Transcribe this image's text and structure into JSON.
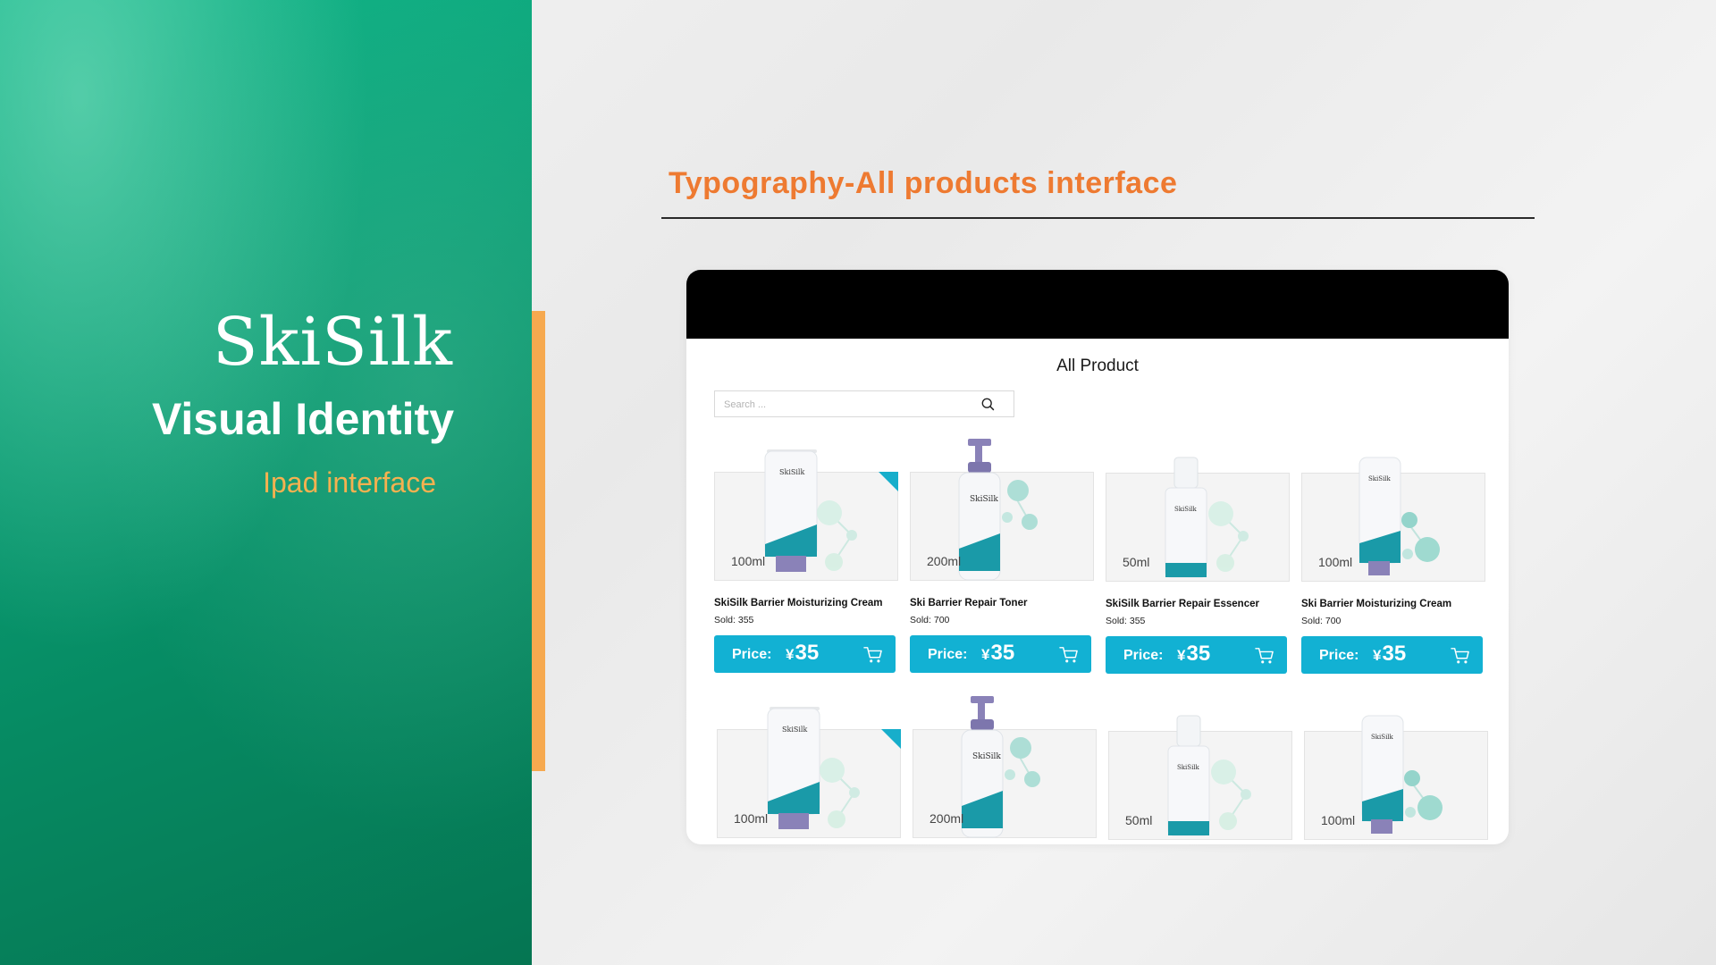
{
  "brand": {
    "logo": "SkiSilk",
    "title": "Visual Identity",
    "subtitle": "Ipad interface"
  },
  "section": {
    "heading": "Typography-All products interface"
  },
  "app": {
    "title": "All Product",
    "search": {
      "placeholder": "Search ...",
      "value": ""
    },
    "products": [
      {
        "name": "SkiSilk Barrier Moisturizing Cream",
        "sold": "Sold: 355",
        "volume": "100ml",
        "price_label": "Price:",
        "currency": "¥",
        "price": "35",
        "kind": "tube",
        "tagged": true
      },
      {
        "name": "Ski Barrier Repair Toner",
        "sold": "Sold: 700",
        "volume": "200ml",
        "price_label": "Price:",
        "currency": "¥",
        "price": "35",
        "kind": "pump",
        "tagged": false
      },
      {
        "name": "SkiSilk Barrier Repair Essencer",
        "sold": "Sold: 355",
        "volume": "50ml",
        "price_label": "Price:",
        "currency": "¥",
        "price": "35",
        "kind": "foam",
        "tagged": false
      },
      {
        "name": "Ski Barrier Moisturizing Cream",
        "sold": "Sold: 700",
        "volume": "100ml",
        "price_label": "Price:",
        "currency": "¥",
        "price": "35",
        "kind": "tube-small",
        "tagged": false
      },
      {
        "volume": "100ml",
        "kind": "tube",
        "tagged": true
      },
      {
        "volume": "200ml",
        "kind": "pump",
        "tagged": false
      },
      {
        "volume": "50ml",
        "kind": "foam",
        "tagged": false
      },
      {
        "volume": "100ml",
        "kind": "tube-small",
        "tagged": false
      }
    ]
  },
  "colors": {
    "brand_green": "#0a9e74",
    "accent_orange": "#ee7a31",
    "accent_bar": "#f6a94f",
    "price_button": "#12b1d3",
    "product_teal": "#1a9aa8",
    "product_purple": "#8a82b8"
  },
  "icons": {
    "search": "search-icon",
    "cart": "cart-icon"
  }
}
